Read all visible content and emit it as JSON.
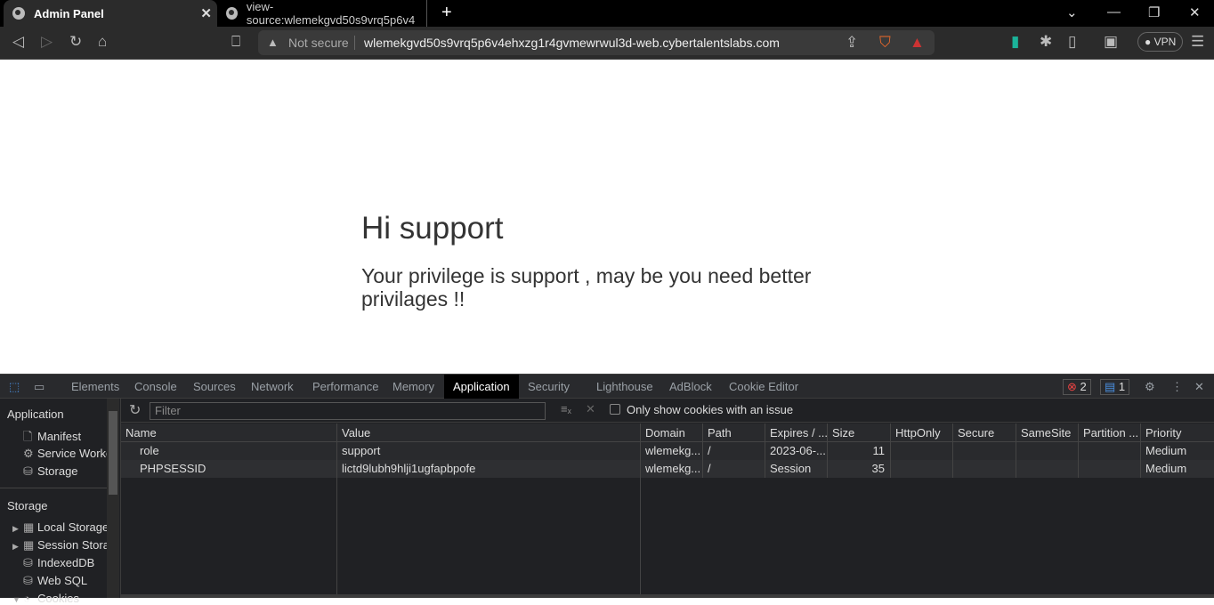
{
  "browser": {
    "tabs": [
      {
        "title": "Admin Panel",
        "active": true
      },
      {
        "title": "view-source:wlemekgvd50s9vrq5p6v4"
      }
    ],
    "address": {
      "security": "Not secure",
      "url": "wlemekgvd50s9vrq5p6v4ehxzg1r4gvmewrwul3d-web.cybertalentslabs.com"
    },
    "vpn_label": "VPN"
  },
  "page": {
    "heading": "Hi support",
    "message": "Your privilege is support , may be you need better privilages !!"
  },
  "devtools": {
    "tabs": [
      "Elements",
      "Console",
      "Sources",
      "Network",
      "Performance",
      "Memory",
      "Application",
      "Security",
      "Lighthouse",
      "AdBlock",
      "Cookie Editor"
    ],
    "selected_tab": "Application",
    "errors": "2",
    "messages": "1",
    "sidebar": {
      "app_heading": "Application",
      "app_items": [
        "Manifest",
        "Service Workers",
        "Storage"
      ],
      "storage_heading": "Storage",
      "storage_items": [
        "Local Storage",
        "Session Storage",
        "IndexedDB",
        "Web SQL",
        "Cookies"
      ]
    },
    "filter_placeholder": "Filter",
    "issue_checkbox_label": "Only show cookies with an issue",
    "columns": [
      "Name",
      "Value",
      "Domain",
      "Path",
      "Expires / ...",
      "Size",
      "HttpOnly",
      "Secure",
      "SameSite",
      "Partition ...",
      "Priority"
    ],
    "cookies": [
      {
        "name": "role",
        "value": "support",
        "domain": "wlemekg...",
        "path": "/",
        "expires": "2023-06-...",
        "size": "11",
        "httponly": "",
        "secure": "",
        "samesite": "",
        "partition": "",
        "priority": "Medium"
      },
      {
        "name": "PHPSESSID",
        "value": "lictd9lubh9hlji1ugfapbpofe",
        "domain": "wlemekg...",
        "path": "/",
        "expires": "Session",
        "size": "35",
        "httponly": "",
        "secure": "",
        "samesite": "",
        "partition": "",
        "priority": "Medium"
      }
    ]
  }
}
